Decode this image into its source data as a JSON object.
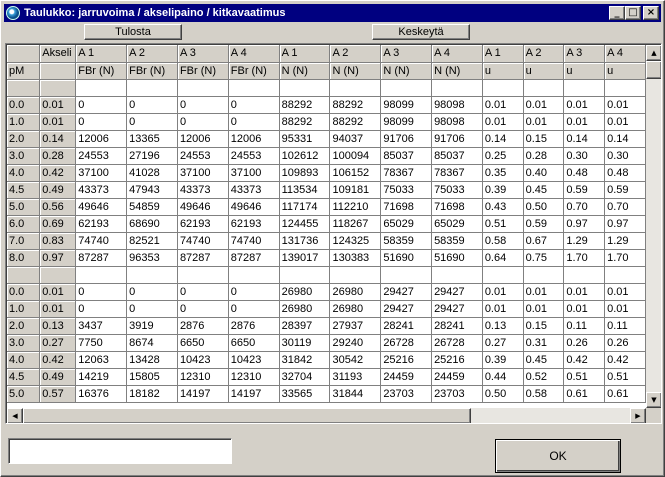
{
  "window": {
    "title": "Taulukko:  jarruvoima / akselipaino / kitkavaatimus",
    "minimize": "_",
    "maximize": "□",
    "close": "×"
  },
  "toolbar": {
    "print_label": "Tulosta",
    "abort_label": "Keskeytä"
  },
  "grid": {
    "header_top": [
      "",
      "Akseli",
      "A 1",
      "A 2",
      "A 3",
      "A 4",
      "A 1",
      "A 2",
      "A 3",
      "A 4",
      "A 1",
      "A 2",
      "A 3",
      "A 4"
    ],
    "header_units": [
      "pM",
      "",
      "FBr (N)",
      "FBr (N)",
      "FBr (N)",
      "FBr (N)",
      "N (N)",
      "N (N)",
      "N (N)",
      "N (N)",
      "u",
      "u",
      "u",
      "u"
    ],
    "rows": [
      [
        "",
        "",
        "",
        "",
        "",
        "",
        "",
        "",
        "",
        "",
        "",
        "",
        "",
        ""
      ],
      [
        "0.0",
        "0.01",
        "0",
        "0",
        "0",
        "0",
        "88292",
        "88292",
        "98099",
        "98098",
        "0.01",
        "0.01",
        "0.01",
        "0.01"
      ],
      [
        "1.0",
        "0.01",
        "0",
        "0",
        "0",
        "0",
        "88292",
        "88292",
        "98099",
        "98098",
        "0.01",
        "0.01",
        "0.01",
        "0.01"
      ],
      [
        "2.0",
        "0.14",
        "12006",
        "13365",
        "12006",
        "12006",
        "95331",
        "94037",
        "91706",
        "91706",
        "0.14",
        "0.15",
        "0.14",
        "0.14"
      ],
      [
        "3.0",
        "0.28",
        "24553",
        "27196",
        "24553",
        "24553",
        "102612",
        "100094",
        "85037",
        "85037",
        "0.25",
        "0.28",
        "0.30",
        "0.30"
      ],
      [
        "4.0",
        "0.42",
        "37100",
        "41028",
        "37100",
        "37100",
        "109893",
        "106152",
        "78367",
        "78367",
        "0.35",
        "0.40",
        "0.48",
        "0.48"
      ],
      [
        "4.5",
        "0.49",
        "43373",
        "47943",
        "43373",
        "43373",
        "113534",
        "109181",
        "75033",
        "75033",
        "0.39",
        "0.45",
        "0.59",
        "0.59"
      ],
      [
        "5.0",
        "0.56",
        "49646",
        "54859",
        "49646",
        "49646",
        "117174",
        "112210",
        "71698",
        "71698",
        "0.43",
        "0.50",
        "0.70",
        "0.70"
      ],
      [
        "6.0",
        "0.69",
        "62193",
        "68690",
        "62193",
        "62193",
        "124455",
        "118267",
        "65029",
        "65029",
        "0.51",
        "0.59",
        "0.97",
        "0.97"
      ],
      [
        "7.0",
        "0.83",
        "74740",
        "82521",
        "74740",
        "74740",
        "131736",
        "124325",
        "58359",
        "58359",
        "0.58",
        "0.67",
        "1.29",
        "1.29"
      ],
      [
        "8.0",
        "0.97",
        "87287",
        "96353",
        "87287",
        "87287",
        "139017",
        "130383",
        "51690",
        "51690",
        "0.64",
        "0.75",
        "1.70",
        "1.70"
      ],
      [
        "",
        "",
        "",
        "",
        "",
        "",
        "",
        "",
        "",
        "",
        "",
        "",
        "",
        ""
      ],
      [
        "0.0",
        "0.01",
        "0",
        "0",
        "0",
        "0",
        "26980",
        "26980",
        "29427",
        "29427",
        "0.01",
        "0.01",
        "0.01",
        "0.01"
      ],
      [
        "1.0",
        "0.01",
        "0",
        "0",
        "0",
        "0",
        "26980",
        "26980",
        "29427",
        "29427",
        "0.01",
        "0.01",
        "0.01",
        "0.01"
      ],
      [
        "2.0",
        "0.13",
        "3437",
        "3919",
        "2876",
        "2876",
        "28397",
        "27937",
        "28241",
        "28241",
        "0.13",
        "0.15",
        "0.11",
        "0.11"
      ],
      [
        "3.0",
        "0.27",
        "7750",
        "8674",
        "6650",
        "6650",
        "30119",
        "29240",
        "26728",
        "26728",
        "0.27",
        "0.31",
        "0.26",
        "0.26"
      ],
      [
        "4.0",
        "0.42",
        "12063",
        "13428",
        "10423",
        "10423",
        "31842",
        "30542",
        "25216",
        "25216",
        "0.39",
        "0.45",
        "0.42",
        "0.42"
      ],
      [
        "4.5",
        "0.49",
        "14219",
        "15805",
        "12310",
        "12310",
        "32704",
        "31193",
        "24459",
        "24459",
        "0.44",
        "0.52",
        "0.51",
        "0.51"
      ],
      [
        "5.0",
        "0.57",
        "16376",
        "18182",
        "14197",
        "14197",
        "33565",
        "31844",
        "23703",
        "23703",
        "0.50",
        "0.58",
        "0.61",
        "0.61"
      ]
    ]
  },
  "scroll": {
    "up": "▲",
    "down": "▼",
    "left": "◀",
    "right": "▶"
  },
  "footer": {
    "status_value": "",
    "ok_label": "OK"
  }
}
